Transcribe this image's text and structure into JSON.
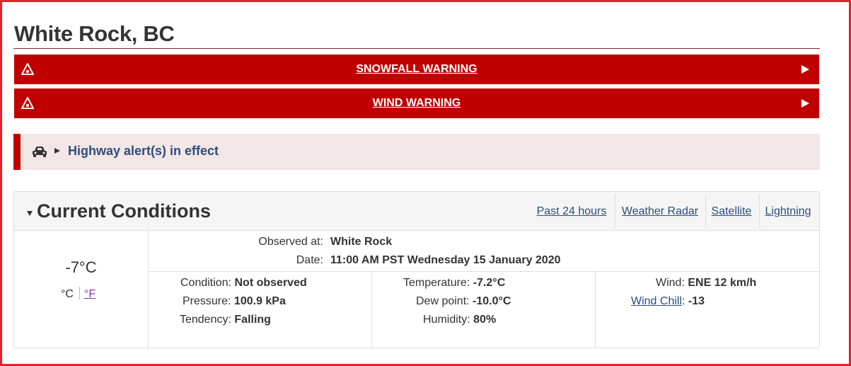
{
  "page": {
    "title": "White Rock, BC"
  },
  "alerts": [
    {
      "label": "SNOWFALL WARNING"
    },
    {
      "label": "WIND WARNING"
    }
  ],
  "highway": {
    "label": "Highway alert(s) in effect"
  },
  "conditions": {
    "title": "Current Conditions",
    "tabs": [
      "Past 24 hours",
      "Weather Radar",
      "Satellite",
      "Lightning"
    ],
    "current_temp": "-7°C",
    "unit_c": "°C",
    "unit_f": "°F",
    "observed_label": "Observed at:",
    "observed_value": "White Rock",
    "date_label": "Date:",
    "date_value": "11:00 AM PST Wednesday 15 January 2020",
    "condition_label": "Condition:",
    "condition_value": "Not observed",
    "pressure_label": "Pressure:",
    "pressure_value": "100.9 kPa",
    "tendency_label": "Tendency:",
    "tendency_value": "Falling",
    "temperature_label": "Temperature:",
    "temperature_value": "-7.2°C",
    "dewpoint_label": "Dew point:",
    "dewpoint_value": "-10.0°C",
    "humidity_label": "Humidity:",
    "humidity_value": "80%",
    "wind_label": "Wind:",
    "wind_value": "ENE 12 km/h",
    "windchill_label": "Wind Chill",
    "windchill_value": "-13"
  },
  "colors": {
    "alert_red": "#c00000",
    "highway_bg": "#f2e6e6",
    "link_blue": "#2b4d78",
    "frame_red": "#e3242b"
  }
}
